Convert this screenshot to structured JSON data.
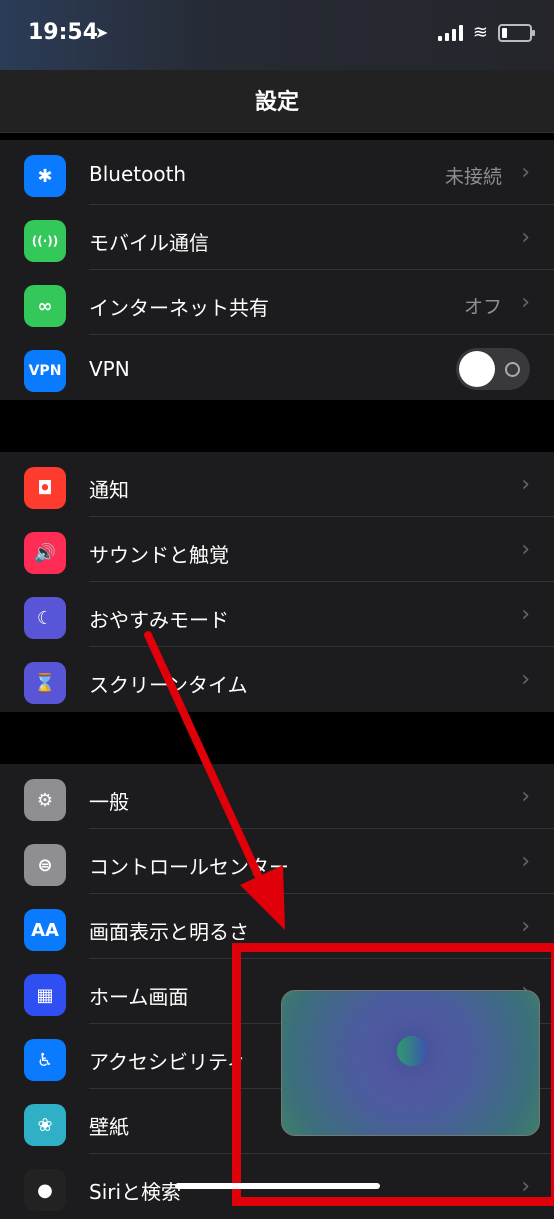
{
  "status_bar": {
    "time": "19:54",
    "location_icon": "location-arrow-icon"
  },
  "nav": {
    "title": "設定"
  },
  "sections": [
    [
      {
        "label": "Bluetooth",
        "value": "未接続",
        "icon": "bluetooth-icon",
        "icon_text": "✱",
        "color": "#0a7aff"
      },
      {
        "label": "モバイル通信",
        "value": "",
        "icon": "antenna-icon",
        "icon_text": "((·))",
        "color": "#34c759"
      },
      {
        "label": "インターネット共有",
        "value": "オフ",
        "icon": "link-icon",
        "icon_text": "∞",
        "color": "#34c759"
      },
      {
        "label": "VPN",
        "value": "",
        "icon": "vpn-icon",
        "icon_text": "VPN",
        "color": "#0a7aff",
        "toggle": false
      }
    ],
    [
      {
        "label": "通知",
        "icon": "notification-icon",
        "icon_text": "◘",
        "color": "#ff3b30"
      },
      {
        "label": "サウンドと触覚",
        "icon": "speaker-icon",
        "icon_text": "🔊",
        "color": "#ff2d55"
      },
      {
        "label": "おやすみモード",
        "icon": "moon-icon",
        "icon_text": "☾",
        "color": "#5856d6"
      },
      {
        "label": "スクリーンタイム",
        "icon": "hourglass-icon",
        "icon_text": "⌛",
        "color": "#5856d6"
      }
    ],
    [
      {
        "label": "一般",
        "icon": "gear-icon",
        "icon_text": "⚙",
        "color": "#8e8e93"
      },
      {
        "label": "コントロールセンター",
        "icon": "switches-icon",
        "icon_text": "⊜",
        "color": "#8e8e93"
      },
      {
        "label": "画面表示と明るさ",
        "icon": "text-size-icon",
        "icon_text": "AA",
        "color": "#0a7aff"
      },
      {
        "label": "ホーム画面",
        "icon": "home-grid-icon",
        "icon_text": "▦",
        "color": "#2f4ff2"
      },
      {
        "label": "アクセシビリティ",
        "icon": "accessibility-icon",
        "icon_text": "♿",
        "color": "#0a7aff"
      },
      {
        "label": "壁紙",
        "icon": "wallpaper-icon",
        "icon_text": "❀",
        "color": "#30b0c7"
      },
      {
        "label": "Siriと検索",
        "icon": "siri-icon",
        "icon_text": "●",
        "color": "#222"
      }
    ]
  ]
}
